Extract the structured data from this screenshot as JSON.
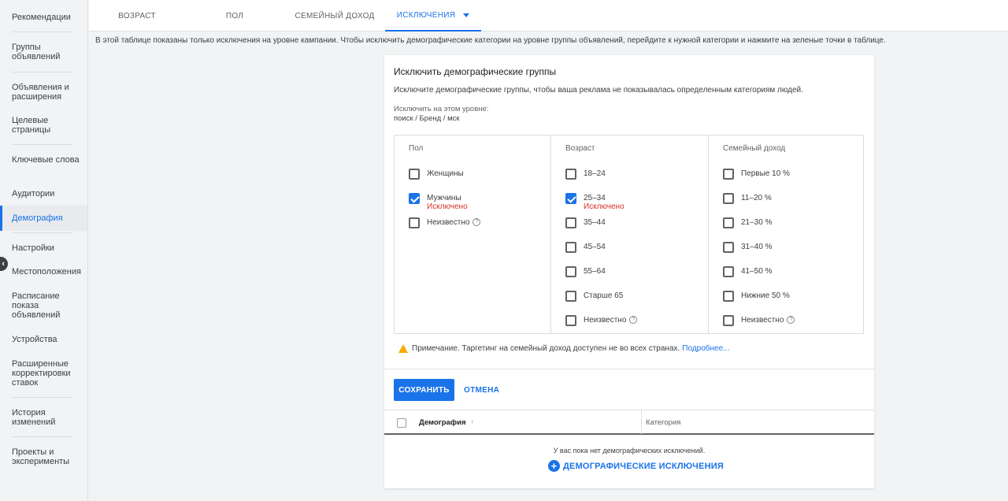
{
  "sidebar": {
    "items": [
      {
        "label": "Рекомендации"
      },
      {
        "label": "Группы объявлений"
      },
      {
        "label": "Объявления и расширения"
      },
      {
        "label": "Целевые страницы"
      },
      {
        "label": "Ключевые слова"
      },
      {
        "label": "Аудитории"
      },
      {
        "label": "Демография"
      },
      {
        "label": "Настройки"
      },
      {
        "label": "Местоположения"
      },
      {
        "label": "Расписание показа объявлений"
      },
      {
        "label": "Устройства"
      },
      {
        "label": "Расширенные корректировки ставок"
      },
      {
        "label": "История изменений"
      },
      {
        "label": "Проекты и эксперименты"
      }
    ],
    "active": "Демография"
  },
  "tabs": [
    {
      "label": "ВОЗРАСТ"
    },
    {
      "label": "ПОЛ"
    },
    {
      "label": "СЕМЕЙНЫЙ ДОХОД"
    },
    {
      "label": "ИСКЛЮЧЕНИЯ"
    }
  ],
  "info_text": "В этой таблице показаны только исключения на уровне кампании. Чтобы исключить демографические категории на уровне группы объявлений, перейдите к нужной категории и нажмите на зеленые точки в таблице.",
  "card": {
    "title": "Исключить демографические группы",
    "description": "Исключите демографические группы, чтобы ваша реклама не показывалась определенным категориям людей.",
    "level_label": "Исключить на этом уровне:",
    "level_value": "поиск / Бренд / мск",
    "excluded_label": "Исключено",
    "columns": [
      {
        "header": "Пол",
        "options": [
          {
            "label": "Женщины",
            "checked": false
          },
          {
            "label": "Мужчины",
            "checked": true
          },
          {
            "label": "Неизвестно",
            "checked": false
          }
        ]
      },
      {
        "header": "Возраст",
        "options": [
          {
            "label": "18–24",
            "checked": false
          },
          {
            "label": "25–34",
            "checked": true
          },
          {
            "label": "35–44",
            "checked": false
          },
          {
            "label": "45–54",
            "checked": false
          },
          {
            "label": "55–64",
            "checked": false
          },
          {
            "label": "Старше 65",
            "checked": false
          },
          {
            "label": "Неизвестно",
            "checked": false
          }
        ]
      },
      {
        "header": "Семейный доход",
        "options": [
          {
            "label": "Первые 10 %",
            "checked": false
          },
          {
            "label": "11–20 %",
            "checked": false
          },
          {
            "label": "21–30 %",
            "checked": false
          },
          {
            "label": "31–40 %",
            "checked": false
          },
          {
            "label": "41–50 %",
            "checked": false
          },
          {
            "label": "Нижние 50 %",
            "checked": false
          },
          {
            "label": "Неизвестно",
            "checked": false
          }
        ]
      }
    ],
    "note_text": "Примечание. Таргетинг на семейный доход доступен не во всех странах.",
    "note_link": "Подробнее...",
    "save_label": "СОХРАНИТЬ",
    "cancel_label": "ОТМЕНА"
  },
  "table": {
    "col1": "Демография",
    "col2": "Категория",
    "empty_message": "У вас пока нет демографических исключений.",
    "add_label": "ДЕМОГРАФИЧЕСКИЕ ИСКЛЮЧЕНИЯ"
  },
  "colors": {
    "accent": "#1a73e8",
    "excluded": "#d93025",
    "warning": "#f9ab00"
  }
}
